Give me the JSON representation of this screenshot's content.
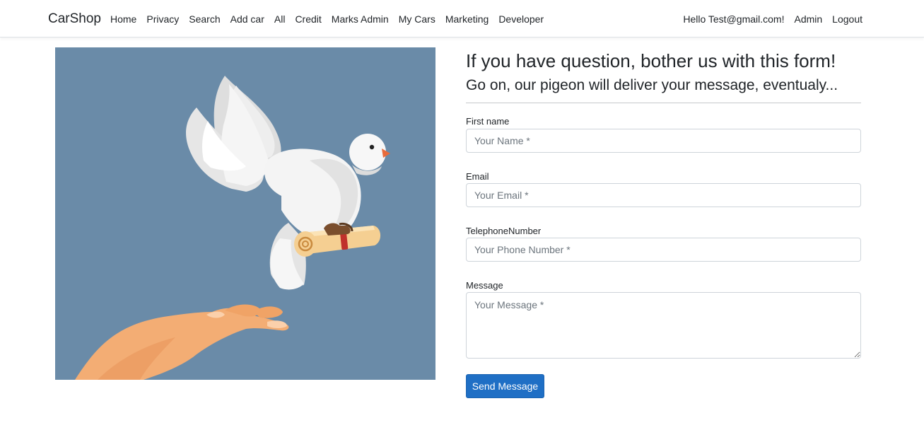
{
  "navbar": {
    "brand": "CarShop",
    "left_links": [
      "Home",
      "Privacy",
      "Search",
      "Add car",
      "All",
      "Credit",
      "Marks Admin",
      "My Cars",
      "Marketing",
      "Developer"
    ],
    "greeting": "Hello Test@gmail.com!",
    "admin_label": "Admin",
    "logout_label": "Logout"
  },
  "illustration": {
    "icon": "dove-with-scroll-illustration",
    "background": "#6a8ba8"
  },
  "contact": {
    "heading": "If you have question, bother us with this form!",
    "subheading": "Go on, our pigeon will deliver your message, eventualy...",
    "first_name": {
      "label": "First name",
      "placeholder": "Your Name *",
      "value": ""
    },
    "email": {
      "label": "Email",
      "placeholder": "Your Email *",
      "value": ""
    },
    "phone": {
      "label": "TelephoneNumber",
      "placeholder": "Your Phone Number *",
      "value": ""
    },
    "message": {
      "label": "Message",
      "placeholder": "Your Message *",
      "value": ""
    },
    "submit_label": "Send Message"
  },
  "colors": {
    "primary": "#1f6fc5",
    "illustration_bg": "#6a8ba8"
  }
}
